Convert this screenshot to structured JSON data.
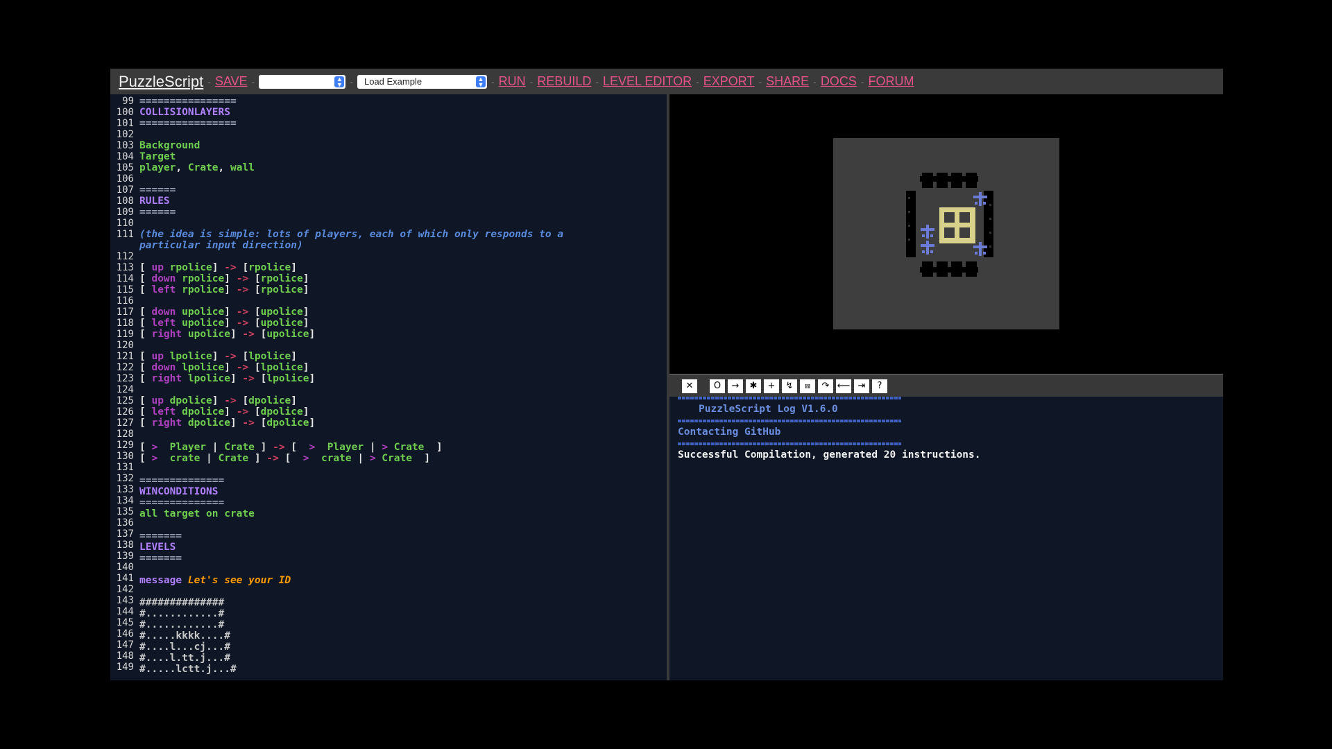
{
  "toolbar": {
    "logo": "PuzzleScript",
    "save": "SAVE",
    "saved_select": "",
    "example_select": "Load Example",
    "run": "RUN",
    "rebuild": "REBUILD",
    "level_editor": "LEVEL EDITOR",
    "export": "EXPORT",
    "share": "SHARE",
    "docs": "DOCS",
    "forum": "FORUM"
  },
  "editor": {
    "line_numbers": [
      "99",
      "100",
      "101",
      "102",
      "103",
      "104",
      "105",
      "106",
      "107",
      "108",
      "109",
      "110",
      "111",
      "",
      "112",
      "113",
      "114",
      "115",
      "116",
      "117",
      "118",
      "119",
      "120",
      "121",
      "122",
      "123",
      "124",
      "125",
      "126",
      "127",
      "128",
      "129",
      "130",
      "131",
      "132",
      "133",
      "134",
      "135",
      "136",
      "137",
      "138",
      "139",
      "140",
      "141",
      "142",
      "143",
      "144",
      "145",
      "146",
      "147",
      "148",
      "149"
    ],
    "lines": {
      "l99": "================",
      "l100": "COLLISIONLAYERS",
      "l101": "================",
      "l103": "Background",
      "l104": "Target",
      "l105a": "player",
      "l105b": ", ",
      "l105c": "Crate",
      "l105d": ", ",
      "l105e": "wall",
      "l107": "======",
      "l108": "RULES",
      "l109": "======",
      "l111a": "(the idea is simple: lots of players, each of which only responds to a",
      "l111b": "particular input direction)",
      "rules": [
        {
          "dir": "up",
          "obj": "rpolice",
          "out": "rpolice"
        },
        {
          "dir": "down",
          "obj": "rpolice",
          "out": "rpolice"
        },
        {
          "dir": "left",
          "obj": "rpolice",
          "out": "rpolice"
        },
        {
          "dir": "down",
          "obj": "upolice",
          "out": "upolice"
        },
        {
          "dir": "left",
          "obj": "upolice",
          "out": "upolice"
        },
        {
          "dir": "right",
          "obj": "upolice",
          "out": "upolice"
        },
        {
          "dir": "up",
          "obj": "lpolice",
          "out": "lpolice"
        },
        {
          "dir": "down",
          "obj": "lpolice",
          "out": "lpolice"
        },
        {
          "dir": "right",
          "obj": "lpolice",
          "out": "lpolice"
        },
        {
          "dir": "up",
          "obj": "dpolice",
          "out": "dpolice"
        },
        {
          "dir": "left",
          "obj": "dpolice",
          "out": "dpolice"
        },
        {
          "dir": "right",
          "obj": "dpolice",
          "out": "dpolice"
        }
      ],
      "l129": {
        "a": "[ ",
        "b": ">",
        "c": "  Player ",
        "d": "| ",
        "e": "Crate ",
        "f": "] ",
        "g": "->",
        "h": " [  ",
        "i": ">",
        "j": "  Player ",
        "k": "| ",
        "l": ">",
        "m": " Crate  ",
        "n": "]"
      },
      "l130": {
        "a": "[ ",
        "b": ">",
        "c": "  crate ",
        "d": "| ",
        "e": "Crate ",
        "f": "] ",
        "g": "->",
        "h": " [  ",
        "i": ">",
        "j": "  crate ",
        "k": "| ",
        "l": ">",
        "m": " Crate  ",
        "n": "]"
      },
      "l132": "==============",
      "l133": "WINCONDITIONS",
      "l134": "==============",
      "l135": "all target on crate",
      "l137": "=======",
      "l138": "LEVELS",
      "l139": "=======",
      "l141a": "message",
      "l141b": " Let's see your ID",
      "l143": "##############",
      "l144": "#............#",
      "l145": "#............#",
      "l146": "#.....kkkk....#",
      "l147": "#....l...cj...#",
      "l148": "#....l.tt.j...#",
      "l149": "#.....lctt.j...#"
    }
  },
  "console": {
    "icons": [
      "close-icon",
      "action-icon",
      "right-icon",
      "star-icon",
      "plus-icon",
      "zigzag-icon",
      "swap-icon",
      "redo-icon",
      "undo-icon",
      "indent-icon",
      "help-icon"
    ],
    "icon_glyphs": [
      "✕",
      "O",
      "→",
      "✱",
      "+",
      "↯",
      "⩎",
      "↷",
      "⟵",
      "⇥",
      "?"
    ],
    "log_title": "PuzzleScript Log V1.6.0",
    "contacting": "Contacting GitHub",
    "status": "Successful Compilation, generated 20 instructions."
  },
  "colors": {
    "link": "#e8528a",
    "editor_bg": "#0f1625",
    "crate": "#d7d18a",
    "police": "#6a7bd8"
  }
}
